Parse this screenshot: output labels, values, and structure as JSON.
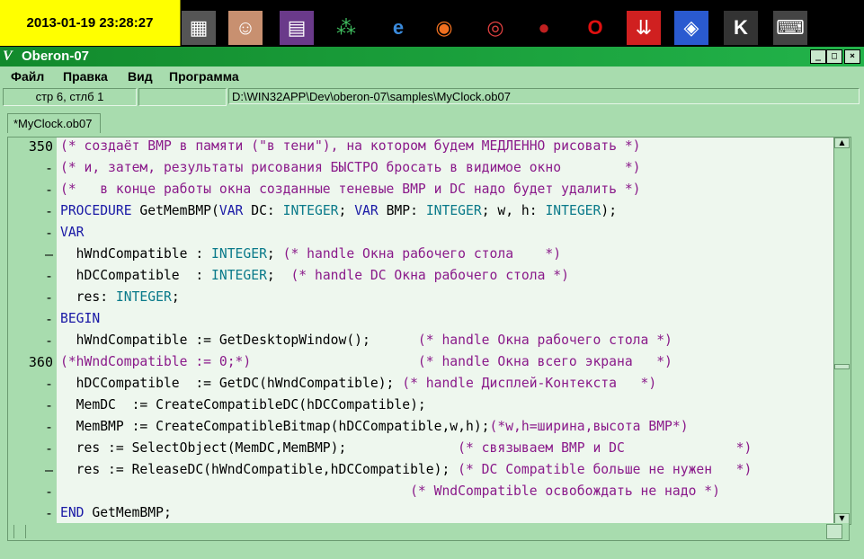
{
  "taskbar": {
    "clock": "2013-01-19 23:28:27",
    "icons": [
      "grid-icon",
      "anime-face-icon",
      "winrar-icon",
      "network-icon",
      "internet-explorer-icon",
      "firefox-icon",
      "chrome-icon",
      "red-app-icon",
      "opera-icon",
      "down-arrows-icon",
      "blue-target-icon",
      "k-icon",
      "keyboard-icon"
    ]
  },
  "window": {
    "title": "Oberon-07",
    "app_icon": "V",
    "controls": {
      "minimize": "_",
      "maximize": "□",
      "close": "×"
    }
  },
  "menu": [
    "Файл",
    "Правка",
    "Вид",
    "Программа"
  ],
  "status": {
    "position": "стр 6, стлб 1",
    "blank": "",
    "path": "D:\\WIN32APP\\Dev\\oberon-07\\samples\\MyClock.ob07"
  },
  "tab": {
    "label": "*MyClock.ob07"
  },
  "colors": {
    "accent": "#22b34a",
    "keyword": "#1a1aa6",
    "type": "#0a7a8a",
    "comment": "#8a1a8a",
    "background": "#a8dcae",
    "code_bg": "#eef7ee"
  },
  "code": {
    "gutter": [
      "350",
      "-",
      "-",
      "-",
      "-",
      "–",
      "-",
      "-",
      "-",
      "-",
      "360",
      "-",
      "-",
      "-",
      "-",
      "–",
      "-",
      "-"
    ],
    "lines": [
      [
        {
          "t": "(* создаёт BMP в памяти (\"в тени\"), на котором будем МЕДЛЕННО рисовать *)",
          "c": "cm"
        }
      ],
      [
        {
          "t": "(* и, затем, результаты рисования БЫСТРО бросать в видимое окно        *)",
          "c": "cm"
        }
      ],
      [
        {
          "t": "(*   в конце работы окна созданные теневые BMP и DC надо будет удалить *)",
          "c": "cm"
        }
      ],
      [
        {
          "t": "PROCEDURE",
          "c": "kw"
        },
        {
          "t": " GetMemBMP(",
          "c": "plain"
        },
        {
          "t": "VAR",
          "c": "kw"
        },
        {
          "t": " DC: ",
          "c": "plain"
        },
        {
          "t": "INTEGER",
          "c": "ty"
        },
        {
          "t": "; ",
          "c": "plain"
        },
        {
          "t": "VAR",
          "c": "kw"
        },
        {
          "t": " BMP: ",
          "c": "plain"
        },
        {
          "t": "INTEGER",
          "c": "ty"
        },
        {
          "t": "; w, h: ",
          "c": "plain"
        },
        {
          "t": "INTEGER",
          "c": "ty"
        },
        {
          "t": ");",
          "c": "plain"
        }
      ],
      [
        {
          "t": "VAR",
          "c": "kw"
        }
      ],
      [
        {
          "t": "  hWndCompatible : ",
          "c": "plain"
        },
        {
          "t": "INTEGER",
          "c": "ty"
        },
        {
          "t": "; ",
          "c": "plain"
        },
        {
          "t": "(* handle Окна рабочего стола    *)",
          "c": "cm"
        }
      ],
      [
        {
          "t": "  hDCCompatible  : ",
          "c": "plain"
        },
        {
          "t": "INTEGER",
          "c": "ty"
        },
        {
          "t": ";  ",
          "c": "plain"
        },
        {
          "t": "(* handle DC Окна рабочего стола *)",
          "c": "cm"
        }
      ],
      [
        {
          "t": "  res: ",
          "c": "plain"
        },
        {
          "t": "INTEGER",
          "c": "ty"
        },
        {
          "t": ";",
          "c": "plain"
        }
      ],
      [
        {
          "t": "BEGIN",
          "c": "kw"
        }
      ],
      [
        {
          "t": "  hWndCompatible := GetDesktopWindow();      ",
          "c": "plain"
        },
        {
          "t": "(* handle Окна рабочего стола *)",
          "c": "cm"
        }
      ],
      [
        {
          "t": "(*hWndCompatible := 0;*)                     (* handle Окна всего экрана   *)",
          "c": "cm"
        }
      ],
      [
        {
          "t": "  hDCCompatible  := GetDC(hWndCompatible); ",
          "c": "plain"
        },
        {
          "t": "(* handle Дисплей-Контекста   *)",
          "c": "cm"
        }
      ],
      [
        {
          "t": "  MemDC  := CreateCompatibleDC(hDCCompatible);",
          "c": "plain"
        }
      ],
      [
        {
          "t": "  MemBMP := CreateCompatibleBitmap(hDCCompatible,w,h);",
          "c": "plain"
        },
        {
          "t": "(*w,h=ширина,высота BMP*)",
          "c": "cm"
        }
      ],
      [
        {
          "t": "  res := SelectObject(MemDC,MemBMP);              ",
          "c": "plain"
        },
        {
          "t": "(* связываем BMP и DC              *)",
          "c": "cm"
        }
      ],
      [
        {
          "t": "  res := ReleaseDC(hWndCompatible,hDCCompatible); ",
          "c": "plain"
        },
        {
          "t": "(* DC Compatible больше не нужен   *)",
          "c": "cm"
        }
      ],
      [
        {
          "t": "                                            ",
          "c": "plain"
        },
        {
          "t": "(* WndCompatible освобождать не надо *)",
          "c": "cm"
        }
      ],
      [
        {
          "t": "END",
          "c": "kw"
        },
        {
          "t": " GetMemBMP;",
          "c": "plain"
        }
      ]
    ]
  },
  "scroll": {
    "vertical_position": 0.6,
    "horizontal_position": 0
  }
}
